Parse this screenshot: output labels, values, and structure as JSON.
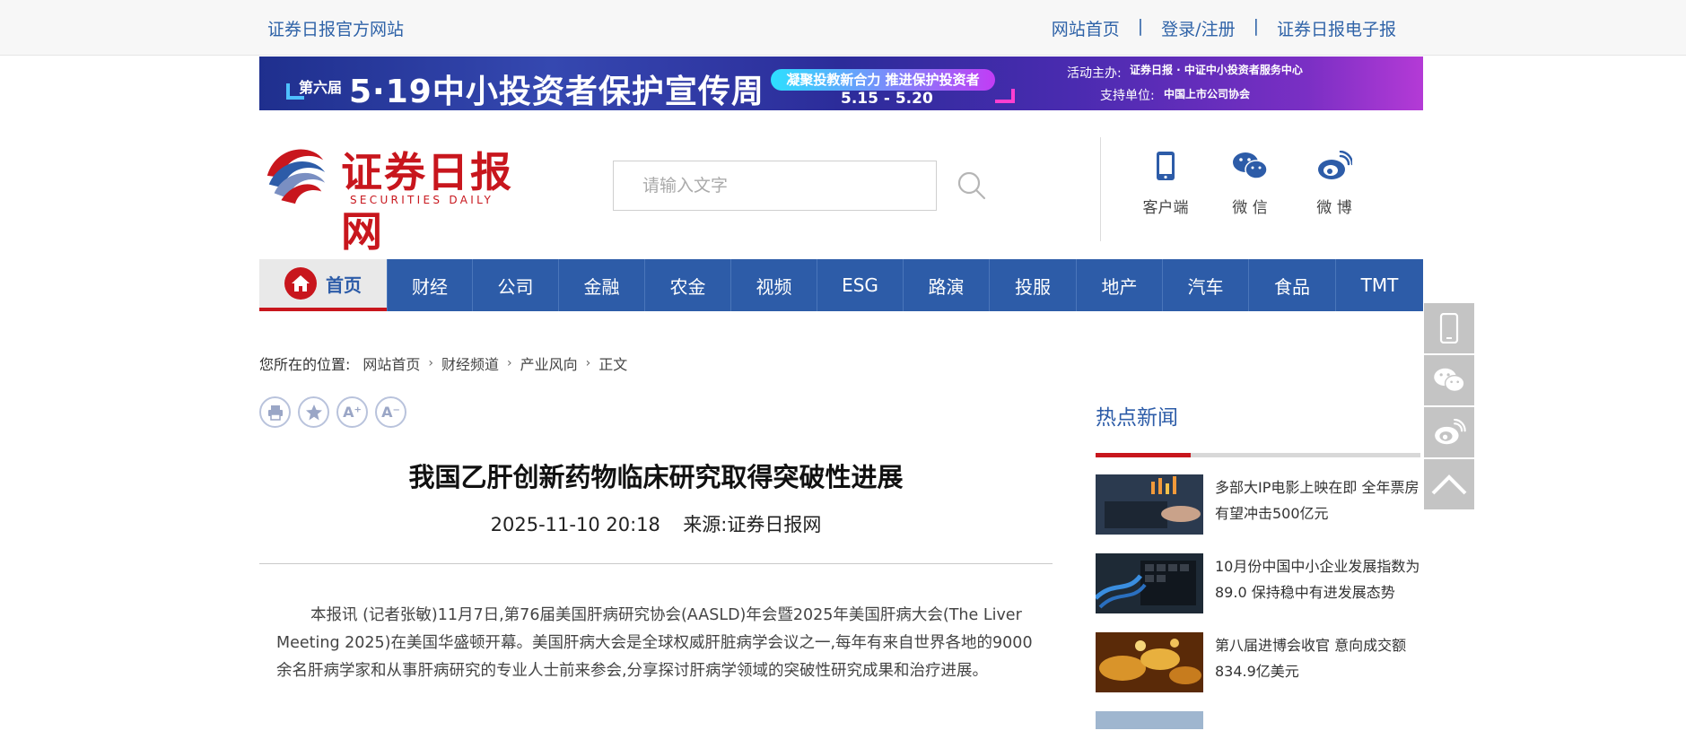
{
  "topbar": {
    "site_name": "证券日报官方网站",
    "links": [
      "网站首页",
      "登录/注册",
      "证券日报电子报"
    ],
    "separator": "|"
  },
  "banner": {
    "edition": "第六届",
    "headline": "5·19中小投资者保护宣传周",
    "slogan": "凝聚投教新合力 推进保护投资者",
    "dates": "5.15 - 5.20",
    "organizer_label": "活动主办:",
    "organizer_names": "证券日报 · 中证中小投资者服务中心",
    "supporter_label": "支持单位:",
    "supporter_name": "中国上市公司协会"
  },
  "logo": {
    "cn": "证券日报网",
    "en": "SECURITIES DAILY",
    "colors": {
      "red": "#c8161d",
      "blue": "#2d5ca8"
    }
  },
  "search": {
    "placeholder": "请输入文字",
    "icon": "search-icon"
  },
  "apps": [
    {
      "label": "客户端",
      "icon": "mobile-icon"
    },
    {
      "label": "微 信",
      "icon": "wechat-icon"
    },
    {
      "label": "微 博",
      "icon": "weibo-icon"
    }
  ],
  "nav": {
    "home": "首页",
    "items": [
      "财经",
      "公司",
      "金融",
      "农金",
      "视频",
      "ESG",
      "路演",
      "投服",
      "地产",
      "汽车",
      "食品",
      "TMT"
    ],
    "accent": "#2d5ca8"
  },
  "float_bar": [
    "mobile-icon",
    "wechat-icon",
    "weibo-icon",
    "back-to-top-icon"
  ],
  "breadcrumb": {
    "lead": "您所在的位置:",
    "items": [
      "网站首页",
      "财经频道",
      "产业风向",
      "正文"
    ]
  },
  "tools": {
    "print": "print-icon",
    "favorite": "star-icon",
    "font_up": "A⁺",
    "font_down": "A⁻"
  },
  "article": {
    "title": "我国乙肝创新药物临床研究取得突破性进展",
    "datetime": "2025-11-10 20:18",
    "source": "来源:证券日报网",
    "body": "本报讯 (记者张敏)11月7日,第76届美国肝病研究协会(AASLD)年会暨2025年美国肝病大会(The Liver Meeting 2025)在美国华盛顿开幕。美国肝病大会是全球权威肝脏病学会议之一,每年有来自世界各地的9000余名肝病学家和从事肝病研究的专业人士前来参会,分享探讨肝病学领域的突破性研究成果和治疗进展。"
  },
  "hot_news": {
    "title": "热点新闻",
    "items": [
      {
        "text": "多部大IP电影上映在即 全年票房有望冲击500亿元"
      },
      {
        "text": "10月份中国中小企业发展指数为89.0 保持稳中有进发展态势"
      },
      {
        "text": "第八届进博会收官 意向成交额834.9亿美元"
      }
    ]
  }
}
